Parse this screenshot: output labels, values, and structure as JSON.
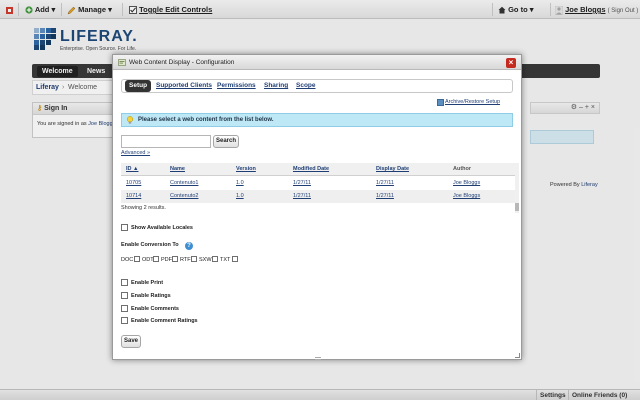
{
  "dockbar": {
    "add_label": "Add",
    "manage_label": "Manage",
    "toggle_label": "Toggle Edit Controls",
    "goto_label": "Go to",
    "user_name": "Joe Bloggs",
    "signout_label": "( Sign Out )"
  },
  "brand": {
    "logo_text": "LIFERAY.",
    "tagline": "Enterprise. Open Source. For Life."
  },
  "nav": {
    "tabs": [
      {
        "label": "Welcome",
        "active": true
      },
      {
        "label": "News",
        "active": false
      }
    ]
  },
  "breadcrumbs": [
    "Liferay",
    "Welcome"
  ],
  "signin_portlet": {
    "title": "Sign In",
    "body_text": "You are signed in as",
    "body_link": "Joe Blogg"
  },
  "powered_by": {
    "prefix": "Powered By",
    "link": "Liferay"
  },
  "bottom_bar": {
    "settings_label": "Settings",
    "online_friends_label": "Online Friends (0)"
  },
  "dialog": {
    "title": "Web Content Display - Configuration",
    "close_glyph": "×",
    "tabs": [
      "Setup",
      "Supported Clients",
      "Permissions",
      "Sharing",
      "Scope"
    ],
    "archive_label": "Archive/Restore Setup",
    "message": "Please select a web content from the list below.",
    "search": {
      "value": "",
      "placeholder": "",
      "button_label": "Search",
      "advanced_label": "Advanced »"
    },
    "table": {
      "columns": [
        "ID ▲",
        "Name",
        "Version",
        "Modified Date",
        "Display Date",
        "Author"
      ],
      "rows": [
        [
          "10705",
          "Contenuto1",
          "1.0",
          "1/27/11",
          "1/27/11",
          "Joe Bloggs"
        ],
        [
          "10714",
          "Contenuto2",
          "1.0",
          "1/27/11",
          "1/27/11",
          "Joe Bloggs"
        ]
      ],
      "results_text": "Showing 2 results."
    },
    "show_locales_label": "Show Available Locales",
    "conversion": {
      "title": "Enable Conversion To",
      "formats": [
        "DOC",
        "ODT",
        "PDF",
        "RTF",
        "SXW",
        "TXT"
      ]
    },
    "options": [
      "Enable Print",
      "Enable Ratings",
      "Enable Comments",
      "Enable Comment Ratings"
    ],
    "save_label": "Save"
  },
  "colors": {
    "brand_blue": "#1e4a7b",
    "link": "#1f3e74",
    "message_bg": "#bfe8f6",
    "close_red": "#c42a1f",
    "nav_bg": "#3a3a3a"
  }
}
